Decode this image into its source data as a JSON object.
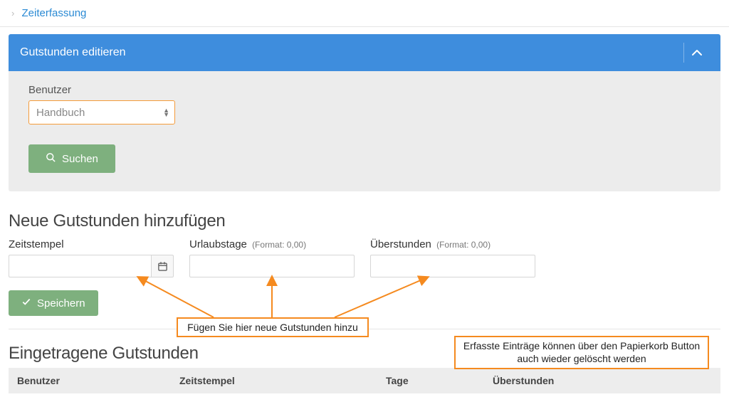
{
  "breadcrumb": {
    "label": "Zeiterfassung"
  },
  "panel": {
    "title": "Gutstunden editieren",
    "user_label": "Benutzer",
    "user_value": "Handbuch",
    "search_label": "Suchen"
  },
  "add": {
    "heading": "Neue Gutstunden hinzufügen",
    "timestamp_label": "Zeitstempel",
    "vacation_label": "Urlaubstage",
    "overtime_label": "Überstunden",
    "format_hint": "(Format: 0,00)",
    "save_label": "Speichern"
  },
  "entries": {
    "heading": "Eingetragene Gutstunden",
    "cols": {
      "user": "Benutzer",
      "timestamp": "Zeitstempel",
      "days": "Tage",
      "overtime": "Überstunden"
    }
  },
  "annotations": {
    "add_here": "Fügen Sie hier neue Gutstunden hinzu",
    "delete_hint": "Erfasste Einträge können über den Papierkorb Button auch wieder gelöscht werden"
  }
}
